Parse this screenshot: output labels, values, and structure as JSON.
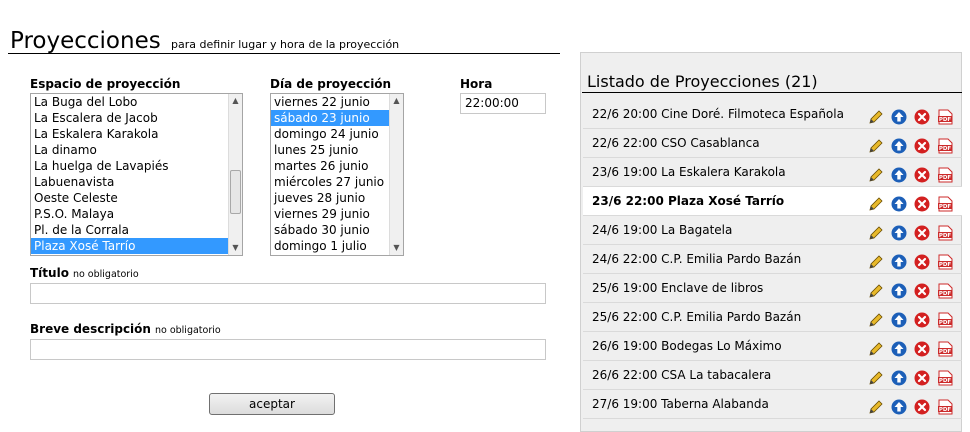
{
  "header": {
    "title": "Proyecciones",
    "subtitle": "para definir lugar y hora de la proyección"
  },
  "form": {
    "espacio_label": "Espacio de proyección",
    "espacio_options": [
      "La Buga del Lobo",
      "La Escalera de Jacob",
      "La Eskalera Karakola",
      "La dinamo",
      "La huelga de Lavapiés",
      "Labuenavista",
      "Oeste Celeste",
      "P.S.O. Malaya",
      "Pl. de la Corrala",
      "Plaza Xosé Tarrío"
    ],
    "espacio_selected": "Plaza Xosé Tarrío",
    "dia_label": "Día de proyección",
    "dia_options": [
      "viernes 22 junio",
      "sábado 23 junio",
      "domingo 24 junio",
      "lunes 25 junio",
      "martes 26 junio",
      "miércoles 27 junio",
      "jueves 28 junio",
      "viernes 29 junio",
      "sábado 30 junio",
      "domingo 1 julio"
    ],
    "dia_selected": "sábado 23 junio",
    "hora_label": "Hora",
    "hora_value": "22:00:00",
    "titulo_label": "Título",
    "titulo_note": "no obligatorio",
    "titulo_value": "",
    "desc_label": "Breve descripción",
    "desc_note": "no obligatorio",
    "desc_value": "",
    "accept_label": "aceptar"
  },
  "listado": {
    "title": "Listado de Proyecciones (21)",
    "items": [
      {
        "text": "22/6 20:00 Cine Doré. Filmoteca Española",
        "highlighted": false
      },
      {
        "text": "22/6 22:00 CSO Casablanca",
        "highlighted": false
      },
      {
        "text": "23/6 19:00 La Eskalera Karakola",
        "highlighted": false
      },
      {
        "text": "23/6 22:00 Plaza Xosé Tarrío",
        "highlighted": true
      },
      {
        "text": "24/6 19:00 La Bagatela",
        "highlighted": false
      },
      {
        "text": "24/6 22:00 C.P. Emilia Pardo Bazán",
        "highlighted": false
      },
      {
        "text": "25/6 19:00 Enclave de libros",
        "highlighted": false
      },
      {
        "text": "25/6 22:00 C.P. Emilia Pardo Bazán",
        "highlighted": false
      },
      {
        "text": "26/6 19:00 Bodegas Lo Máximo",
        "highlighted": false
      },
      {
        "text": "26/6 22:00 CSA La tabacalera",
        "highlighted": false
      },
      {
        "text": "27/6 19:00 Taberna Alabanda",
        "highlighted": false
      }
    ],
    "icons": [
      "pencil-icon",
      "arrow-up-icon",
      "delete-icon",
      "pdf-icon"
    ],
    "pdf_label": "PDF"
  },
  "colors": {
    "selection": "#3399ff",
    "up_icon": "#1c5fb8",
    "delete_icon": "#d32020",
    "pdf_icon": "#cc2a2a"
  }
}
